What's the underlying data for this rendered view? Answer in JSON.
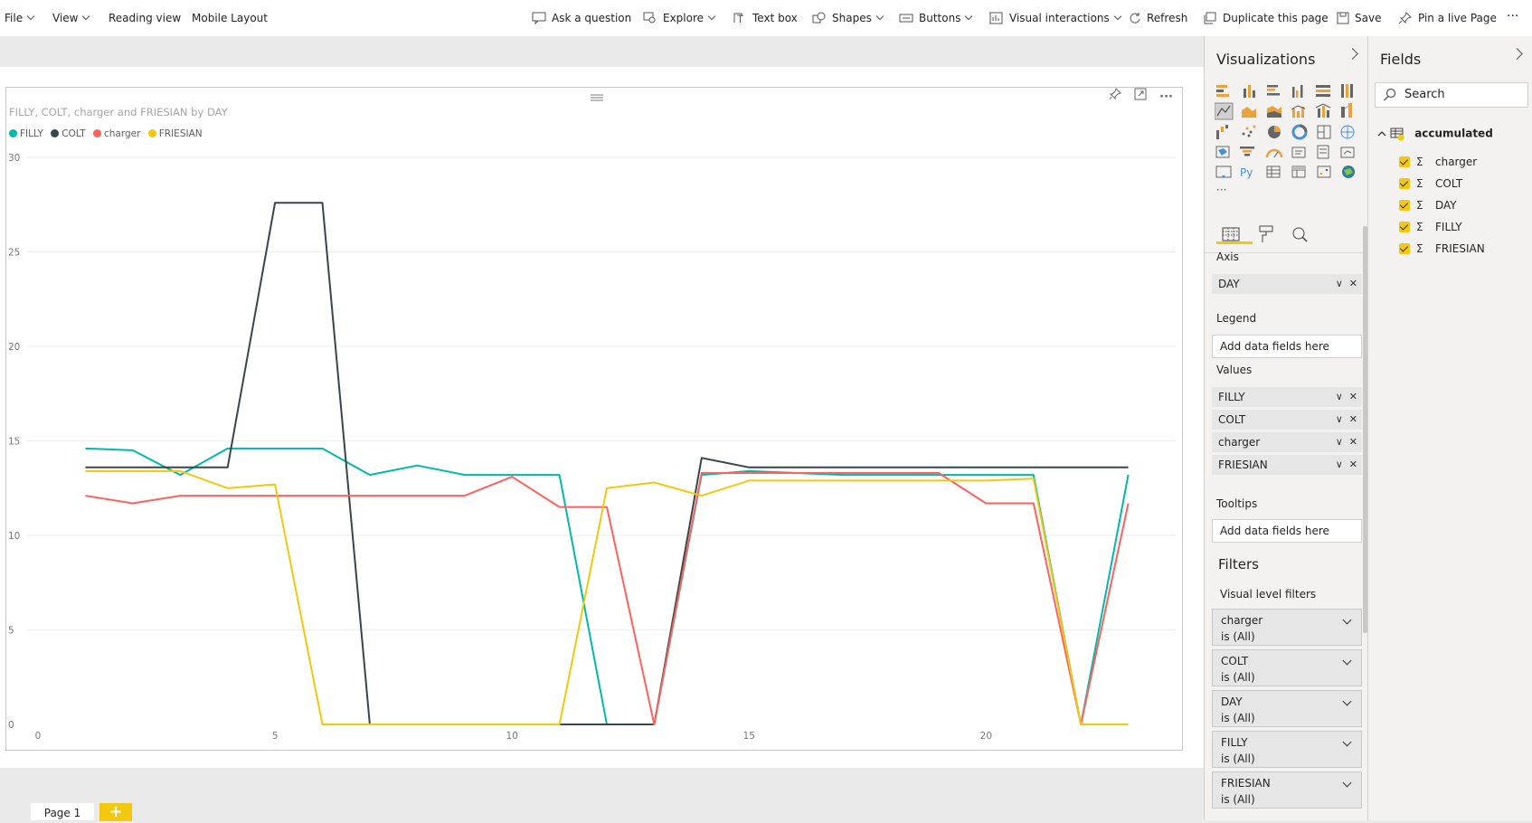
{
  "ribbon": {
    "file": "File",
    "view": "View",
    "reading_view": "Reading view",
    "mobile_layout": "Mobile Layout",
    "ask_question": "Ask a question",
    "explore": "Explore",
    "text_box": "Text box",
    "shapes": "Shapes",
    "buttons": "Buttons",
    "visual_interactions": "Visual interactions",
    "refresh": "Refresh",
    "duplicate_page": "Duplicate this page",
    "save": "Save",
    "pin_live_page": "Pin a live Page",
    "more": "···"
  },
  "visual": {
    "title": "FILLY, COLT, charger and FRIESIAN by DAY",
    "legend": [
      {
        "name": "FILLY",
        "color": "#01b8aa"
      },
      {
        "name": "COLT",
        "color": "#374649"
      },
      {
        "name": "charger",
        "color": "#fd625e"
      },
      {
        "name": "FRIESIAN",
        "color": "#f2c80f"
      }
    ]
  },
  "chart_data": {
    "type": "line",
    "title": "FILLY, COLT, charger and FRIESIAN by DAY",
    "xlabel": "",
    "ylabel": "",
    "x": [
      1,
      2,
      3,
      4,
      5,
      6,
      7,
      8,
      9,
      10,
      11,
      12,
      13,
      14,
      15,
      16,
      17,
      18,
      19,
      20,
      21,
      22,
      23
    ],
    "xlim": [
      0,
      24
    ],
    "ylim": [
      0,
      30
    ],
    "x_ticks": [
      0,
      5,
      10,
      15,
      20
    ],
    "y_ticks": [
      0,
      5,
      10,
      15,
      20,
      25,
      30
    ],
    "grid": true,
    "legend_position": "top-left",
    "series": [
      {
        "name": "FILLY",
        "color": "#01b8aa",
        "values": [
          14.6,
          14.5,
          13.2,
          14.6,
          14.6,
          14.6,
          13.2,
          13.7,
          13.2,
          13.2,
          13.2,
          0,
          0,
          13.2,
          13.4,
          13.3,
          13.2,
          13.2,
          13.2,
          13.2,
          13.2,
          0,
          13.2
        ]
      },
      {
        "name": "COLT",
        "color": "#374649",
        "values": [
          13.6,
          13.6,
          13.6,
          13.6,
          27.6,
          27.6,
          0,
          0,
          0,
          0,
          0,
          0,
          0,
          14.1,
          13.6,
          13.6,
          13.6,
          13.6,
          13.6,
          13.6,
          13.6,
          13.6,
          13.6
        ]
      },
      {
        "name": "charger",
        "color": "#fd625e",
        "values": [
          12.1,
          11.7,
          12.1,
          12.1,
          12.1,
          12.1,
          12.1,
          12.1,
          12.1,
          13.1,
          11.5,
          11.5,
          0,
          13.3,
          13.3,
          13.3,
          13.3,
          13.3,
          13.3,
          11.7,
          11.7,
          0,
          11.7
        ]
      },
      {
        "name": "FRIESIAN",
        "color": "#f2c80f",
        "values": [
          13.4,
          13.4,
          13.4,
          12.5,
          12.7,
          0,
          0,
          0,
          0,
          0,
          0,
          12.5,
          12.8,
          12.1,
          12.9,
          12.9,
          12.9,
          12.9,
          12.9,
          12.9,
          13.0,
          0,
          0
        ]
      }
    ]
  },
  "visualizations": {
    "title": "Visualizations",
    "tabs": [
      "fields-tab",
      "format-tab",
      "analytics-tab"
    ],
    "axis_label": "Axis",
    "axis_field": "DAY",
    "legend_label": "Legend",
    "legend_placeholder": "Add data fields here",
    "values_label": "Values",
    "values": [
      "FILLY",
      "COLT",
      "charger",
      "FRIESIAN"
    ],
    "tooltips_label": "Tooltips",
    "tooltips_placeholder": "Add data fields here",
    "filters_title": "Filters",
    "visual_level_filters": "Visual level filters",
    "filters": [
      {
        "field": "charger",
        "state": "is (All)"
      },
      {
        "field": "COLT",
        "state": "is (All)"
      },
      {
        "field": "DAY",
        "state": "is (All)"
      },
      {
        "field": "FILLY",
        "state": "is (All)"
      },
      {
        "field": "FRIESIAN",
        "state": "is (All)"
      }
    ]
  },
  "fields": {
    "title": "Fields",
    "search_placeholder": "Search",
    "table": "accumulated",
    "items": [
      "charger",
      "COLT",
      "DAY",
      "FILLY",
      "FRIESIAN"
    ]
  },
  "pages": {
    "tab": "Page 1",
    "add": "+"
  }
}
